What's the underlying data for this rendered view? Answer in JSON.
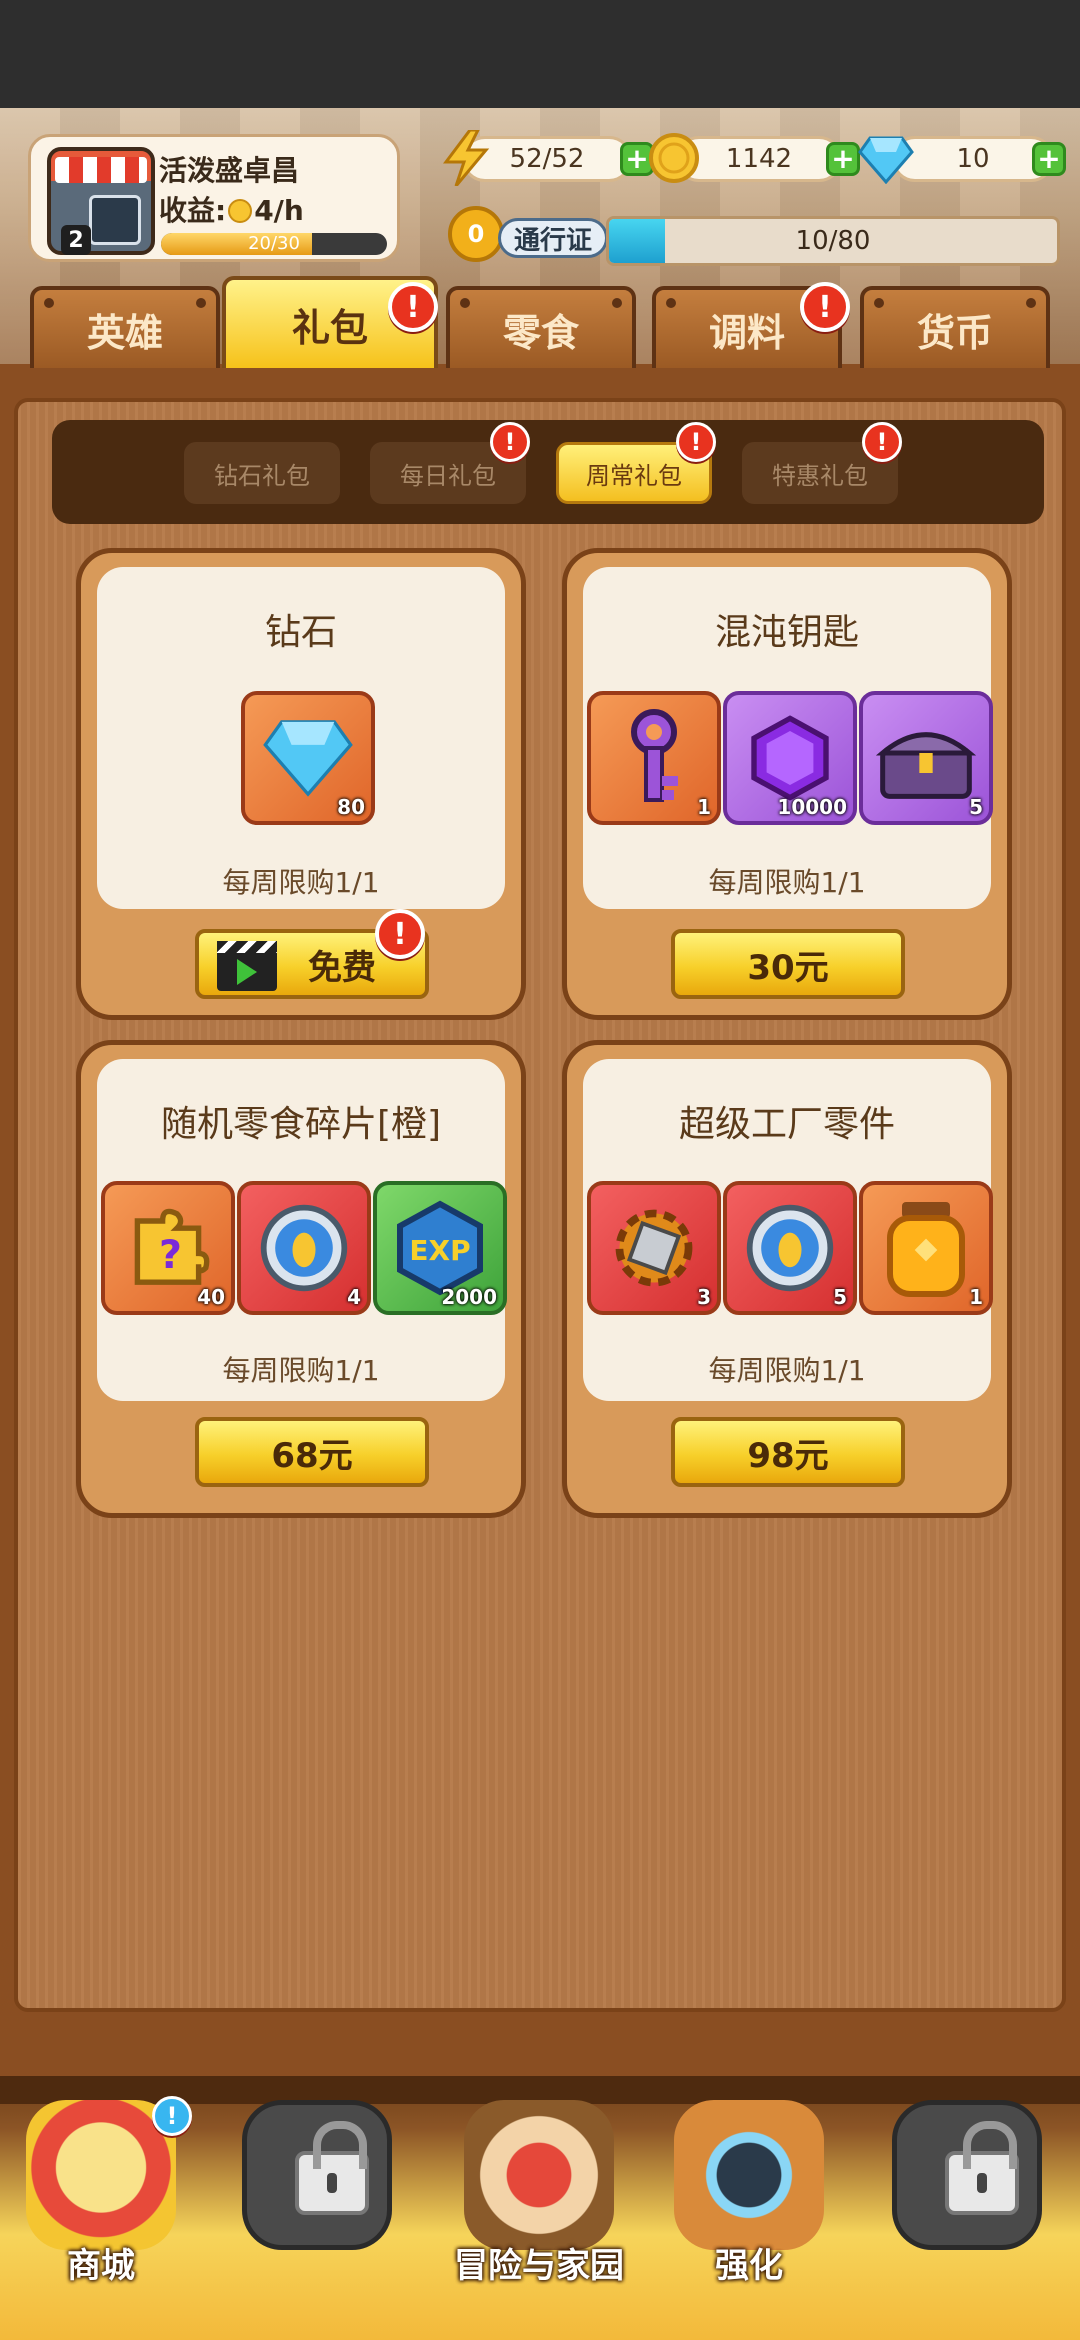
{
  "player": {
    "name": "活泼盛卓昌",
    "level": "2",
    "income_label": "收益:",
    "income_rate": "4/h",
    "progress_text": "20/30",
    "progress_fraction": 0.67
  },
  "resources": {
    "energy": "52/52",
    "coins": "1142",
    "diamonds": "10"
  },
  "pass": {
    "badge": "0",
    "label": "通行证",
    "progress_text": "10/80",
    "progress_fraction": 0.125
  },
  "tabs": [
    {
      "label": "英雄",
      "active": false,
      "alert": false
    },
    {
      "label": "礼包",
      "active": true,
      "alert": true
    },
    {
      "label": "零食",
      "active": false,
      "alert": false
    },
    {
      "label": "调料",
      "active": false,
      "alert": true
    },
    {
      "label": "货币",
      "active": false,
      "alert": false
    }
  ],
  "subtabs": [
    {
      "label": "钻石礼包",
      "active": false,
      "alert": false
    },
    {
      "label": "每日礼包",
      "active": false,
      "alert": true
    },
    {
      "label": "周常礼包",
      "active": true,
      "alert": true
    },
    {
      "label": "特惠礼包",
      "active": false,
      "alert": true
    }
  ],
  "alert_glyph": "!",
  "cards": [
    {
      "title": "钻石",
      "limit": "每周限购1/1",
      "button": "免费",
      "button_type": "ad-video",
      "items": [
        {
          "icon": "diamond-icon",
          "qty": "80"
        }
      ]
    },
    {
      "title": "混沌钥匙",
      "limit": "每周限购1/1",
      "button": "30元",
      "items": [
        {
          "icon": "key-icon",
          "qty": "1"
        },
        {
          "icon": "purple-gem-icon",
          "qty": "10000"
        },
        {
          "icon": "treasure-chest-icon",
          "qty": "5"
        }
      ]
    },
    {
      "title": "随机零食碎片[橙]",
      "limit": "每周限购1/1",
      "button": "68元",
      "items": [
        {
          "icon": "mystery-puzzle-icon",
          "qty": "40"
        },
        {
          "icon": "medal-icon",
          "qty": "4"
        },
        {
          "icon": "exp-badge-icon",
          "qty": "2000",
          "text": "EXP"
        }
      ]
    },
    {
      "title": "超级工厂零件",
      "limit": "每周限购1/1",
      "button": "98元",
      "items": [
        {
          "icon": "gear-part-icon",
          "qty": "3"
        },
        {
          "icon": "medal-icon",
          "qty": "5"
        },
        {
          "icon": "honey-jar-icon",
          "qty": "1"
        }
      ]
    }
  ],
  "bottom_nav": [
    {
      "label": "商城",
      "locked": false,
      "alert": true
    },
    {
      "label": "",
      "locked": true
    },
    {
      "label": "冒险与家园",
      "locked": false
    },
    {
      "label": "强化",
      "locked": false
    },
    {
      "label": "",
      "locked": true
    }
  ],
  "colors": {
    "accent_yellow": "#f7d02a",
    "wood_dark": "#7a4218",
    "alert_red": "#e8331f",
    "plus_green": "#54c23a"
  }
}
